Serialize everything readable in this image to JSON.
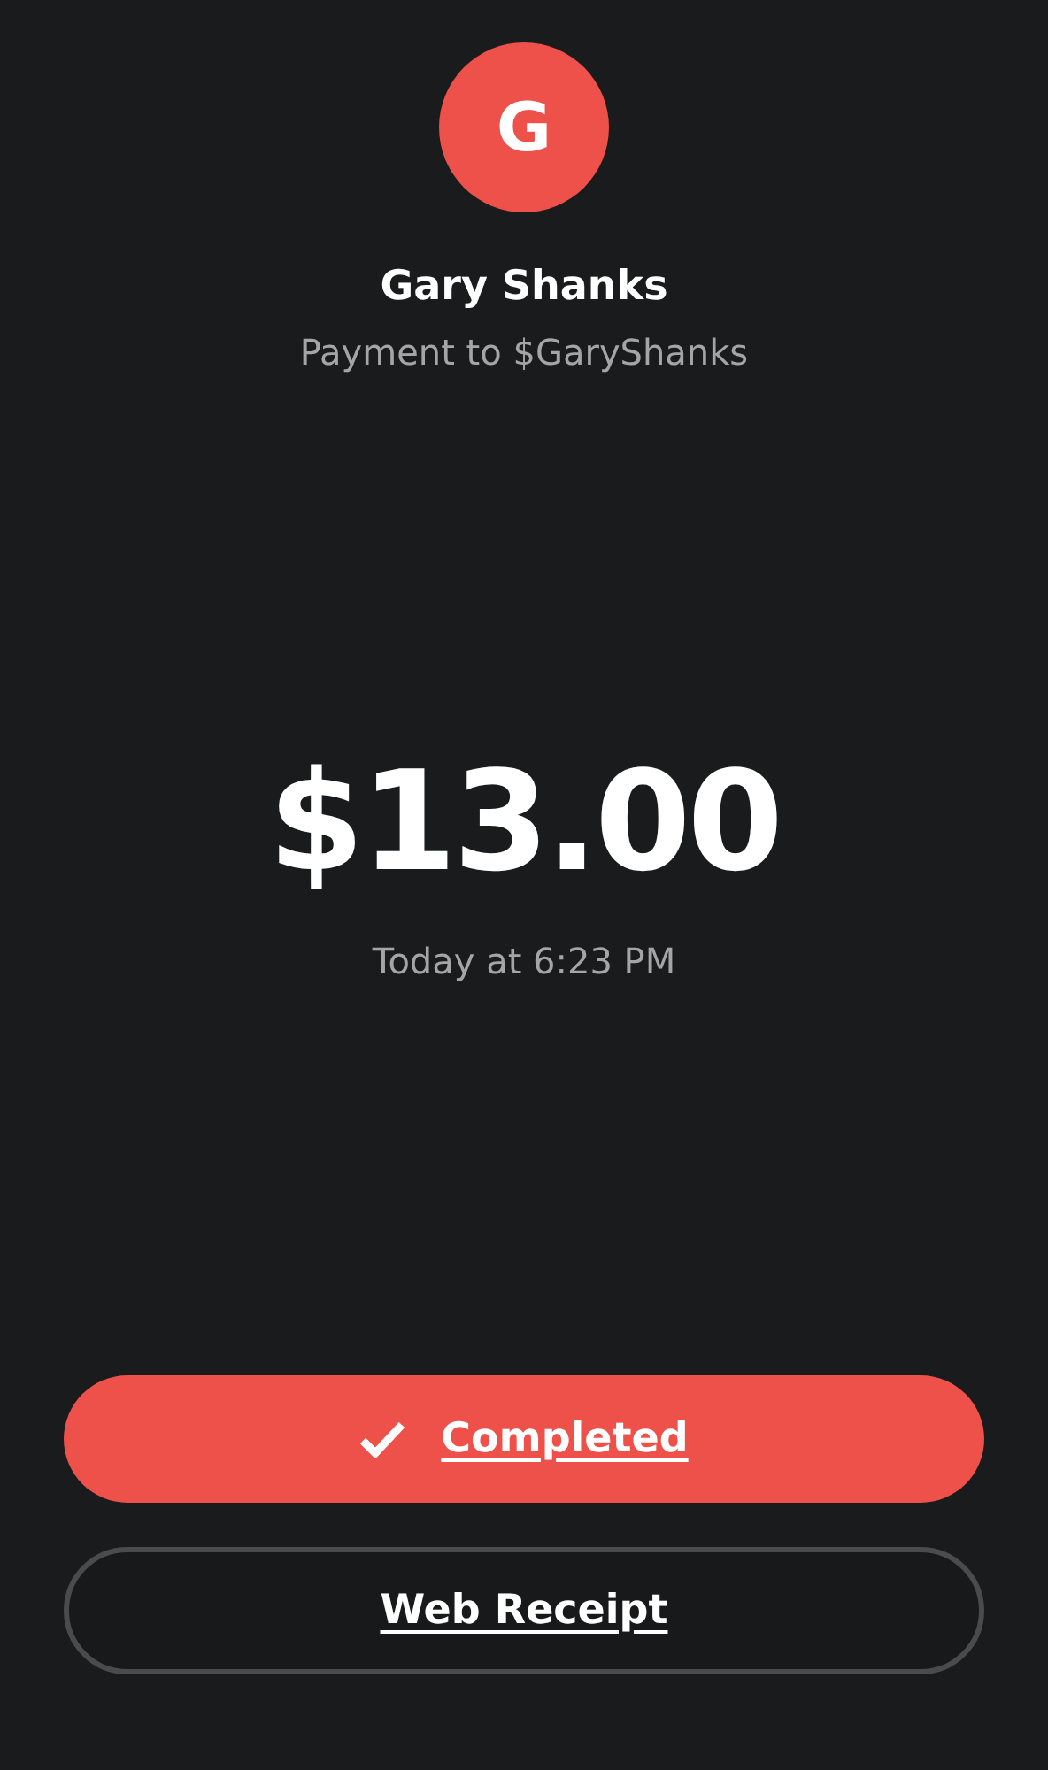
{
  "recipient": {
    "initial": "G",
    "name": "Gary Shanks",
    "subtitle": "Payment to $GaryShanks"
  },
  "payment": {
    "amount": "$13.00",
    "time": "Today at 6:23 PM"
  },
  "buttons": [
    {
      "kind": "primary",
      "label": "Completed"
    },
    {
      "kind": "secondary",
      "label": "Web Receipt"
    }
  ]
}
